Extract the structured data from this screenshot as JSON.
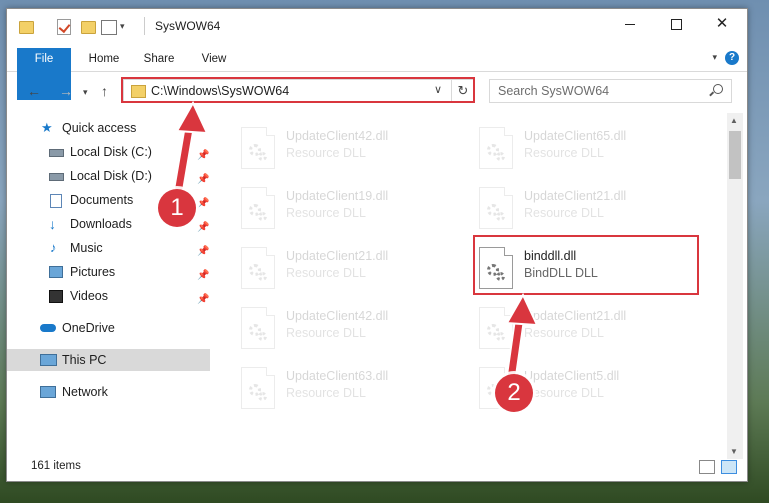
{
  "window": {
    "title": "SysWOW64",
    "controls": [
      "minimize",
      "maximize",
      "✕"
    ]
  },
  "ribbon": {
    "tabs": [
      "File",
      "Home",
      "Share",
      "View"
    ],
    "help": "?"
  },
  "address": {
    "path": "C:\\Windows\\SysWOW64",
    "search_placeholder": "Search SysWOW64"
  },
  "sidebar": {
    "items": [
      {
        "label": "Quick access",
        "icon": "star-icon",
        "pinned": false
      },
      {
        "label": "Local Disk (C:)",
        "icon": "drive-icon",
        "pinned": true
      },
      {
        "label": "Local Disk (D:)",
        "icon": "drive-icon",
        "pinned": true
      },
      {
        "label": "Documents",
        "icon": "documents-icon",
        "pinned": true
      },
      {
        "label": "Downloads",
        "icon": "download-icon",
        "pinned": true
      },
      {
        "label": "Music",
        "icon": "music-icon",
        "pinned": true
      },
      {
        "label": "Pictures",
        "icon": "pictures-icon",
        "pinned": true
      },
      {
        "label": "Videos",
        "icon": "videos-icon",
        "pinned": true
      },
      {
        "label": "OneDrive",
        "icon": "cloud-icon",
        "pinned": false
      },
      {
        "label": "This PC",
        "icon": "computer-icon",
        "pinned": false,
        "selected": true
      },
      {
        "label": "Network",
        "icon": "network-icon",
        "pinned": false
      }
    ]
  },
  "files": [
    {
      "name": "UpdateClient42.dll",
      "type": "Resource DLL",
      "faded": true
    },
    {
      "name": "UpdateClient65.dll",
      "type": "Resource DLL",
      "faded": true
    },
    {
      "name": "UpdateClient19.dll",
      "type": "Resource DLL",
      "faded": true
    },
    {
      "name": "UpdateClient21.dll",
      "type": "Resource DLL",
      "faded": true
    },
    {
      "name": "UpdateClient21.dll",
      "type": "Resource DLL",
      "faded": true
    },
    {
      "name": "binddll.dll",
      "type": "BindDLL DLL",
      "faded": false,
      "highlighted": true
    },
    {
      "name": "UpdateClient42.dll",
      "type": "Resource DLL",
      "faded": true
    },
    {
      "name": "UpdateClient21.dll",
      "type": "Resource DLL",
      "faded": true
    },
    {
      "name": "UpdateClient63.dll",
      "type": "Resource DLL",
      "faded": true
    },
    {
      "name": "UpdateClient5.dll",
      "type": "Resource DLL",
      "faded": true
    }
  ],
  "status": {
    "item_count": "161 items"
  },
  "annotations": {
    "step1": "1",
    "step2": "2",
    "color": "#d9363e"
  }
}
